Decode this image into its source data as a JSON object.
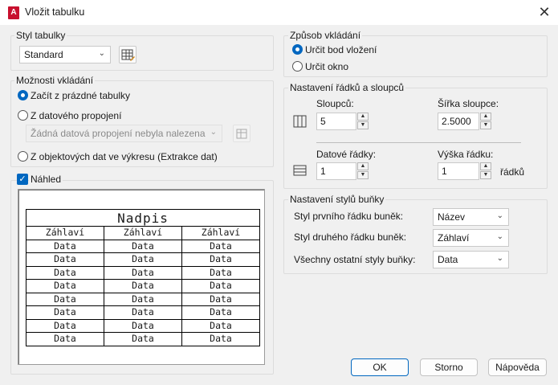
{
  "window": {
    "title": "Vložit tabulku",
    "app_icon": "A",
    "close": "✕"
  },
  "style_group": {
    "label": "Styl tabulky",
    "value": "Standard"
  },
  "insert_options": {
    "label": "Možnosti vkládání",
    "opt_empty": "Začít z prázdné tabulky",
    "opt_datalink": "Z datového propojení",
    "datalink_value": "Žádná datová propojení nebyla nalezena",
    "opt_objects": "Z objektových dat ve výkresu (Extrakce dat)"
  },
  "preview": {
    "label": "Náhled",
    "checked": true,
    "title": "Nadpis",
    "headers": [
      "Záhlaví",
      "Záhlaví",
      "Záhlaví"
    ],
    "rows": [
      [
        "Data",
        "Data",
        "Data"
      ],
      [
        "Data",
        "Data",
        "Data"
      ],
      [
        "Data",
        "Data",
        "Data"
      ],
      [
        "Data",
        "Data",
        "Data"
      ],
      [
        "Data",
        "Data",
        "Data"
      ],
      [
        "Data",
        "Data",
        "Data"
      ],
      [
        "Data",
        "Data",
        "Data"
      ],
      [
        "Data",
        "Data",
        "Data"
      ]
    ]
  },
  "insert_method": {
    "label": "Způsob vkládání",
    "opt_point": "Určit bod vložení",
    "opt_window": "Určit okno"
  },
  "rows_cols": {
    "label": "Nastavení řádků a sloupců",
    "columns_label": "Sloupců:",
    "columns_value": "5",
    "col_width_label": "Šířka sloupce:",
    "col_width_value": "2.5000",
    "data_rows_label": "Datové řádky:",
    "data_rows_value": "1",
    "row_height_label": "Výška řádku:",
    "row_height_value": "1",
    "row_height_unit": "řádků"
  },
  "cell_styles": {
    "label": "Nastavení stylů buňky",
    "first_label": "Styl prvního řádku buněk:",
    "first_value": "Název",
    "second_label": "Styl druhého řádku buněk:",
    "second_value": "Záhlaví",
    "other_label": "Všechny ostatní styly buňky:",
    "other_value": "Data"
  },
  "buttons": {
    "ok": "OK",
    "cancel": "Storno",
    "help": "Nápověda"
  }
}
